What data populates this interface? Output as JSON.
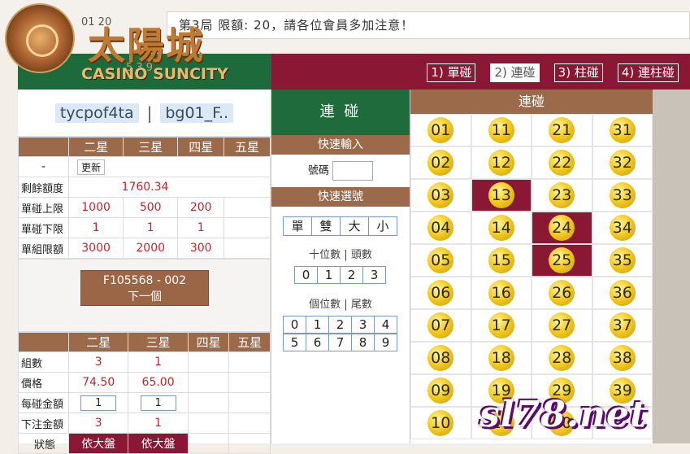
{
  "header": {
    "marquee": "第3局 限額: 20，請各位會員多加注意！",
    "date_fragment": "01 20",
    "logo_cn": "太陽城",
    "logo_en": "CASINO SUNCITY",
    "logo_num": "5 3 9"
  },
  "modes": [
    {
      "label": "1) 單碰",
      "active": false
    },
    {
      "label": "2) 連碰",
      "active": true
    },
    {
      "label": "3) 柱碰",
      "active": false
    },
    {
      "label": "4) 連柱碰",
      "active": false
    }
  ],
  "user": {
    "name": "tycpof4ta",
    "sep": "|",
    "account": "bg01_F.."
  },
  "limits": {
    "headers": [
      "二星",
      "三星",
      "四星",
      "五星"
    ],
    "first_col": "-",
    "update": "更新",
    "rows": [
      {
        "label": "剩餘額度",
        "values": [
          "1760.34"
        ]
      },
      {
        "label": "單碰上限",
        "values": [
          "1000",
          "500",
          "200",
          ""
        ]
      },
      {
        "label": "單碰下限",
        "values": [
          "1",
          "1",
          "1",
          ""
        ]
      },
      {
        "label": "單組限額",
        "values": [
          "3000",
          "2000",
          "300",
          ""
        ]
      }
    ]
  },
  "next": {
    "code": "F105568 - 002",
    "label": "下一個"
  },
  "bet": {
    "headers": [
      "二星",
      "三星",
      "四星",
      "五星"
    ],
    "rows": [
      {
        "label": "組數",
        "values": [
          "3",
          "1",
          "",
          ""
        ]
      },
      {
        "label": "價格",
        "values": [
          "74.50",
          "65.00",
          "",
          ""
        ]
      },
      {
        "label": "每碰金額",
        "values": [
          "1",
          "1",
          "",
          ""
        ]
      },
      {
        "label": "下注金額",
        "values": [
          "3",
          "1",
          "",
          ""
        ]
      },
      {
        "label": "狀態",
        "values": [
          "依大盤",
          "依大盤",
          "",
          ""
        ]
      }
    ]
  },
  "middle": {
    "title": "連 碰",
    "quick_input": "快速輸入",
    "num_label": "號碼",
    "quick_select": "快速選號",
    "qs_buttons": [
      "單",
      "雙",
      "大",
      "小"
    ],
    "tens_label": "十位數 | 頭數",
    "tens": [
      "0",
      "1",
      "2",
      "3"
    ],
    "units_label": "個位數 | 尾數",
    "units": [
      "0",
      "1",
      "2",
      "3",
      "4",
      "5",
      "6",
      "7",
      "8",
      "9"
    ]
  },
  "grid": {
    "title": "連碰",
    "numbers": [
      "01",
      "11",
      "21",
      "31",
      "02",
      "12",
      "22",
      "32",
      "03",
      "13",
      "23",
      "33",
      "04",
      "14",
      "24",
      "34",
      "05",
      "15",
      "25",
      "35",
      "06",
      "16",
      "26",
      "36",
      "07",
      "17",
      "27",
      "37",
      "08",
      "18",
      "28",
      "38",
      "09",
      "19",
      "29",
      "39",
      "10",
      "20",
      "30",
      ""
    ],
    "selected": [
      "13",
      "24",
      "25"
    ]
  },
  "watermark": "sl78.net",
  "colors": {
    "green": "#1f6b3c",
    "brown": "#9a6a4a",
    "maroon": "#8a1734",
    "ball": "#f4cc22"
  }
}
